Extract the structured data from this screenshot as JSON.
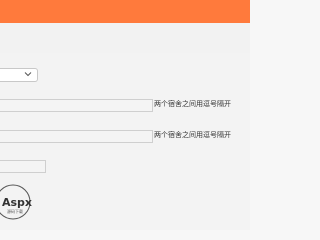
{
  "header": {
    "accent_color": "#ff7a3c"
  },
  "form": {
    "select": {
      "value": ""
    },
    "fields": [
      {
        "value": "",
        "hint": "两个宿舍之间用逗号隔开"
      },
      {
        "value": "",
        "hint": "两个宿舍之间用逗号隔开"
      }
    ],
    "short_field": {
      "value": ""
    }
  },
  "logo": {
    "text": "Aspx",
    "subtext": "源码下载"
  },
  "icons": {
    "select_arrow": "chevron-down-icon"
  }
}
